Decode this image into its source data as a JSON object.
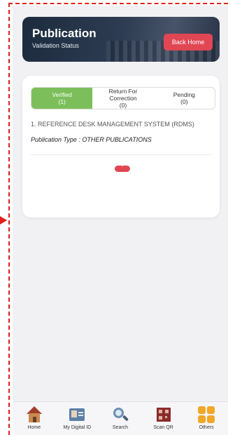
{
  "header": {
    "title": "Publication",
    "subtitle": "Validation Status",
    "back_label": "Back Home"
  },
  "tabs": [
    {
      "label": "Verified",
      "count": "(1)",
      "active": true
    },
    {
      "label": "Return For Correction",
      "count": "(0)",
      "active": false
    },
    {
      "label": "Pending",
      "count": "(0)",
      "active": false
    }
  ],
  "item": {
    "title": "1. REFERENCE DESK MANAGEMENT SYSTEM (RDMS)",
    "type": "Publication Type : OTHER PUBLICATIONS"
  },
  "nav": [
    {
      "label": "Home",
      "icon": "home-icon"
    },
    {
      "label": "My Digital ID",
      "icon": "id-card-icon"
    },
    {
      "label": "Search",
      "icon": "search-icon"
    },
    {
      "label": "Scan QR",
      "icon": "qr-icon"
    },
    {
      "label": "Others",
      "icon": "grid-icon"
    }
  ],
  "colors": {
    "accent_red": "#e14653",
    "verified_green": "#7cbf5a",
    "annotation_red": "#e0201c"
  }
}
